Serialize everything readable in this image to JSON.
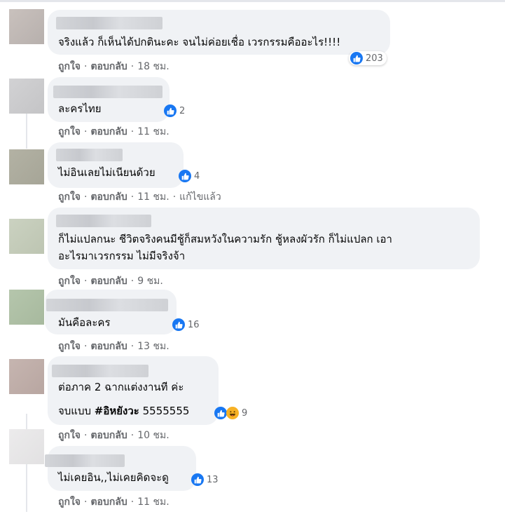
{
  "comments": [
    {
      "text": "จริงแล้ว ก็เห็นได้ปกตินะคะ จนไม่ค่อยเชื่อ เวรกรรมคืออะไร!!!!",
      "reaction_count": "203",
      "like_label": "ถูกใจ",
      "reply_label": "ตอบกลับ",
      "time": "18 ชม."
    },
    {
      "text": "ละครไทย",
      "reaction_count": "2",
      "like_label": "ถูกใจ",
      "reply_label": "ตอบกลับ",
      "time": "11 ชม."
    },
    {
      "text": "ไม่อินเลยไม่เนียนด้วย",
      "reaction_count": "4",
      "like_label": "ถูกใจ",
      "reply_label": "ตอบกลับ",
      "time": "11 ชม.",
      "edited_label": "แก้ไขแล้ว"
    },
    {
      "line1": "ก็ไม่แปลกนะ ชีวิตจริงคนมีชู้ก็สมหวังในความรัก ชู้หลงผัวรัก ก็ไม่แปลก เอา",
      "line2": "อะไรมาเวรกรรม ไม่มีจริงจ้า",
      "like_label": "ถูกใจ",
      "reply_label": "ตอบกลับ",
      "time": "9 ชม."
    },
    {
      "text": "มันคือละคร",
      "reaction_count": "16",
      "like_label": "ถูกใจ",
      "reply_label": "ตอบกลับ",
      "time": "13 ชม."
    },
    {
      "line1": "ต่อภาค 2 ฉากแต่งงานที ค่ะ",
      "line2_prefix": "จบแบบ ",
      "hashtag": "#อิหยังวะ",
      "line2_suffix": " 5555555",
      "reaction_count": "9",
      "like_label": "ถูกใจ",
      "reply_label": "ตอบกลับ",
      "time": "10 ชม."
    },
    {
      "text": "ไม่เคยอิน,,ไม่เคยคิดจะดู",
      "reaction_count": "13",
      "like_label": "ถูกใจ",
      "reply_label": "ตอบกลับ",
      "time": "11 ชม."
    }
  ],
  "separator": "·",
  "icons": {
    "like": "thumbs-up-icon",
    "haha": "laughing-face-icon"
  },
  "colors": {
    "like_blue": "#1877f2",
    "bubble": "#f0f2f5",
    "meta_gray": "#65676b"
  }
}
